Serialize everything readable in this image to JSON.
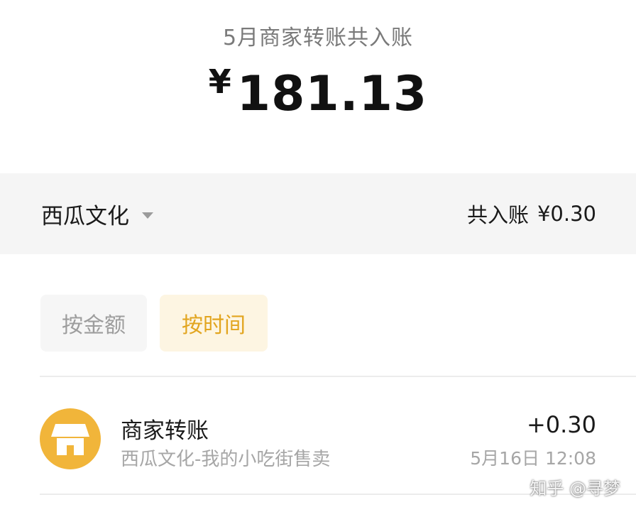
{
  "summary": {
    "title": "5月商家转账共入账",
    "currency": "¥",
    "amount": "181.13"
  },
  "filter": {
    "merchant": "西瓜文化",
    "total_label": "共入账",
    "total_value": "¥0.30"
  },
  "sort": {
    "by_amount": "按金额",
    "by_time": "按时间",
    "active": "by_time"
  },
  "transactions": [
    {
      "icon": "shop-icon",
      "title": "商家转账",
      "subtitle": "西瓜文化-我的小吃街售卖",
      "amount": "+0.30",
      "time": "5月16日 12:08"
    }
  ],
  "colors": {
    "accent": "#E2A51F",
    "avatar": "#F1B53A",
    "active_sort_bg": "#FDF5E2"
  },
  "watermark": "知乎 @寻梦"
}
